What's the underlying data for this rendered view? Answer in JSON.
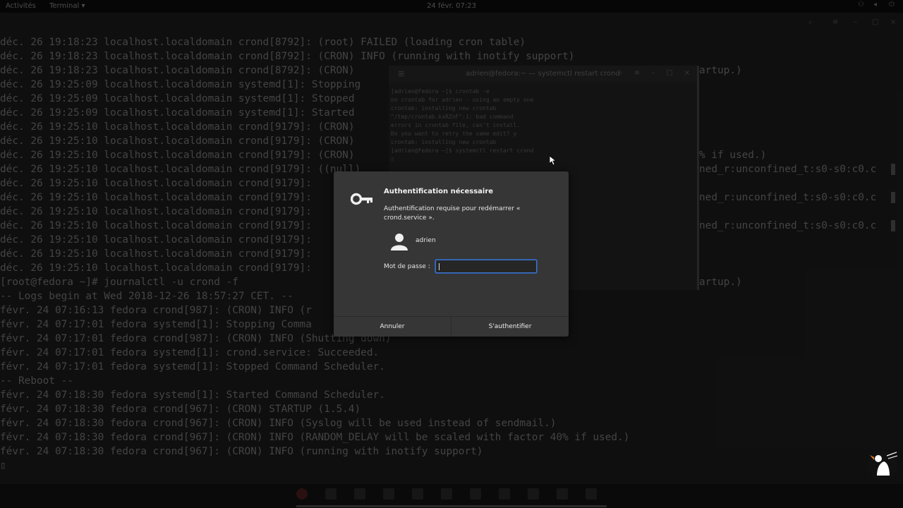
{
  "topbar": {
    "activities": "Activités",
    "app_menu": "Terminal ▾",
    "clock": "24 févr. 07:23"
  },
  "back_terminal": {
    "title": "",
    "log_lines": [
      "déc. 26 19:18:23 localhost.localdomain crond[8792]: (root) FAILED (loading cron table)",
      "déc. 26 19:18:23 localhost.localdomain crond[8792]: (CRON) INFO (running with inotify support)",
      "déc. 26 19:18:23 localhost.localdomain crond[8792]: (CRON)",
      "déc. 26 19:25:09 localhost.localdomain systemd[1]: Stopping",
      "déc. 26 19:25:09 localhost.localdomain systemd[1]: Stopped",
      "déc. 26 19:25:09 localhost.localdomain systemd[1]: Started",
      "déc. 26 19:25:10 localhost.localdomain crond[9179]: (CRON)",
      "déc. 26 19:25:10 localhost.localdomain crond[9179]: (CRON)",
      "déc. 26 19:25:10 localhost.localdomain crond[9179]: (CRON)",
      "déc. 26 19:25:10 localhost.localdomain crond[9179]: ((null)",
      "déc. 26 19:25:10 localhost.localdomain crond[9179]:",
      "déc. 26 19:25:10 localhost.localdomain crond[9179]:",
      "déc. 26 19:25:10 localhost.localdomain crond[9179]:",
      "déc. 26 19:25:10 localhost.localdomain crond[9179]:",
      "déc. 26 19:25:10 localhost.localdomain crond[9179]:",
      "déc. 26 19:25:10 localhost.localdomain crond[9179]:",
      "déc. 26 19:25:10 localhost.localdomain crond[9179]:",
      "[root@fedora ~]# journalctl -u crond -f",
      "-- Logs begin at Wed 2018-12-26 18:57:27 CET. --",
      "févr. 24 07:16:13 fedora crond[987]: (CRON) INFO (r",
      "févr. 24 07:17:01 fedora systemd[1]: Stopping Comma",
      "févr. 24 07:17:01 fedora crond[987]: (CRON) INFO (Shutting down)",
      "févr. 24 07:17:01 fedora systemd[1]: crond.service: Succeeded.",
      "févr. 24 07:17:01 fedora systemd[1]: Stopped Command Scheduler.",
      "-- Reboot --",
      "févr. 24 07:18:30 fedora systemd[1]: Started Command Scheduler.",
      "févr. 24 07:18:30 fedora crond[967]: (CRON) STARTUP (1.5.4)",
      "févr. 24 07:18:30 fedora crond[967]: (CRON) INFO (Syslog will be used instead of sendmail.)",
      "févr. 24 07:18:30 fedora crond[967]: (CRON) INFO (RANDOM_DELAY will be scaled with factor 40% if used.)",
      "févr. 24 07:18:30 fedora crond[967]: (CRON) INFO (running with inotify support)",
      "▯"
    ],
    "right_fragments": [
      "artup.)",
      "",
      "",
      "",
      "",
      "",
      "% if used.)",
      "ned_r:unconfined_t:s0-s0:c0.c",
      "",
      "ned_r:unconfined_t:s0-s0:c0.c",
      "",
      "ned_r:unconfined_t:s0-s0:c0.c",
      "",
      "",
      "",
      "artup.)"
    ]
  },
  "front_terminal": {
    "title": "adrien@fedora:~ — systemctl restart crond",
    "lines": [
      "[adrien@fedora ~]$ crontab -e",
      "no crontab for adrien - using an empty one",
      "crontab: installing new crontab",
      "\"/tmp/crontab.kxRZnF\":1: bad command",
      "errors in crontab file, can't install.",
      "Do you want to retry the same edit? y",
      "crontab: installing new crontab",
      "[adrien@fedora ~]$ systemctl restart crond",
      "▯"
    ]
  },
  "dialog": {
    "title": "Authentification nécessaire",
    "message": "Authentification requise pour redémarrer « crond.service ».",
    "username": "adrien",
    "password_label": "Mot de passe :",
    "password_value": "",
    "cancel_label": "Annuler",
    "authenticate_label": "S'authentifier",
    "accent_color": "#3f73c8"
  }
}
